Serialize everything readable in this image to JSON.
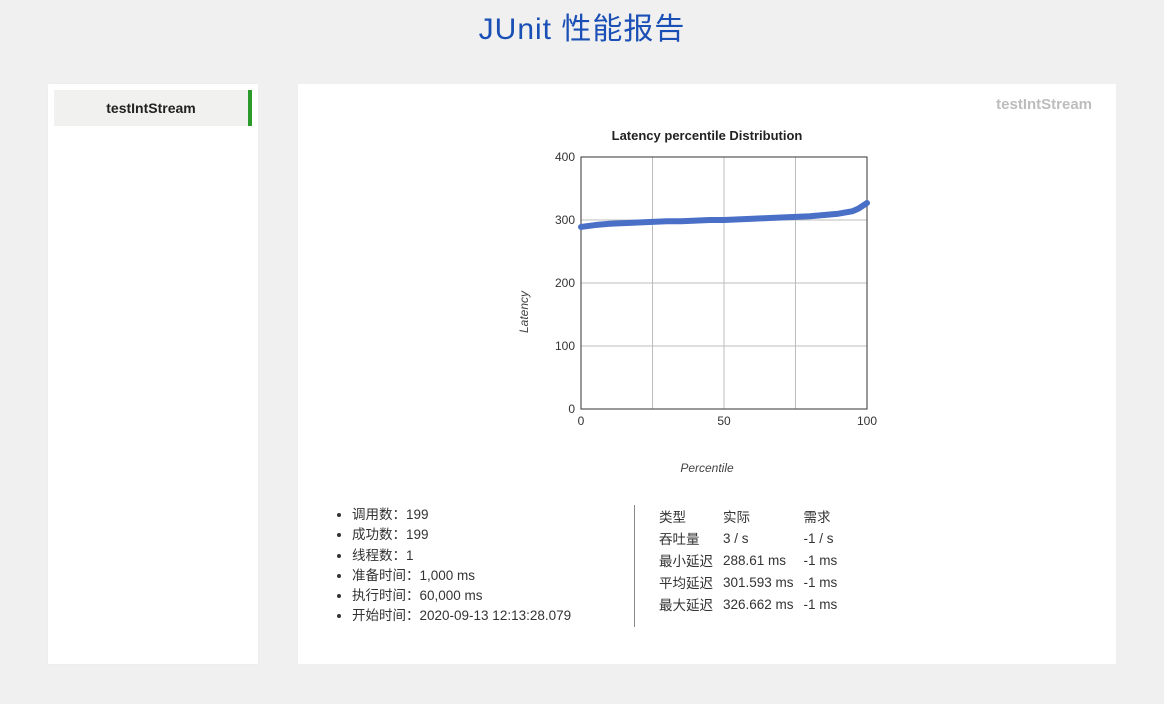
{
  "header": {
    "title": "JUnit 性能报告"
  },
  "sidebar": {
    "items": [
      {
        "label": "testIntStream",
        "active": true
      }
    ]
  },
  "main": {
    "test_name": "testIntStream"
  },
  "summary": {
    "labels": {
      "invocations": "调用数：",
      "successes": "成功数：",
      "threads": "线程数：",
      "warmup": "准备时间：",
      "exec": "执行时间：",
      "start": "开始时间："
    },
    "values": {
      "invocations": "199",
      "successes": "199",
      "threads": "1",
      "warmup": "1,000 ms",
      "exec": "60,000 ms",
      "start": "2020-09-13 12:13:28.079"
    }
  },
  "requirements": {
    "headers": {
      "type": "类型",
      "actual": "实际",
      "req": "需求"
    },
    "rows": [
      {
        "type": "吞吐量",
        "actual": "3 / s",
        "req": "-1 / s"
      },
      {
        "type": "最小延迟",
        "actual": "288.61 ms",
        "req": "-1 ms"
      },
      {
        "type": "平均延迟",
        "actual": "301.593 ms",
        "req": "-1 ms"
      },
      {
        "type": "最大延迟",
        "actual": "326.662 ms",
        "req": "-1 ms"
      }
    ]
  },
  "chart_data": {
    "type": "scatter",
    "title": "Latency percentile Distribution",
    "xlabel": "Percentile",
    "ylabel": "Latency",
    "xlim": [
      0,
      100
    ],
    "ylim": [
      0,
      400
    ],
    "xticks": [
      0,
      50,
      100
    ],
    "yticks": [
      0,
      100,
      200,
      300,
      400
    ],
    "x": [
      0,
      5,
      10,
      15,
      20,
      25,
      30,
      35,
      40,
      45,
      50,
      55,
      60,
      65,
      70,
      75,
      80,
      85,
      90,
      95,
      97,
      99,
      100
    ],
    "values": [
      289,
      292,
      294,
      295,
      296,
      297,
      298,
      298,
      299,
      300,
      300,
      301,
      302,
      303,
      304,
      305,
      306,
      308,
      310,
      314,
      318,
      324,
      327
    ]
  }
}
